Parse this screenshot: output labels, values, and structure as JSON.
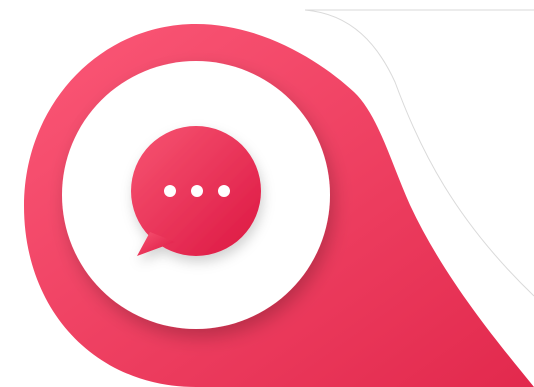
{
  "graphic": {
    "icon": "chat-bubble-typing-icon",
    "colors": {
      "accent_light": "#fb5877",
      "accent_dark": "#e2294d",
      "bubble_light": "#f75572",
      "bubble_dark": "#dc1642",
      "inner_disc": "#ffffff",
      "dots": "#ffffff",
      "outline": "#dadada"
    }
  }
}
